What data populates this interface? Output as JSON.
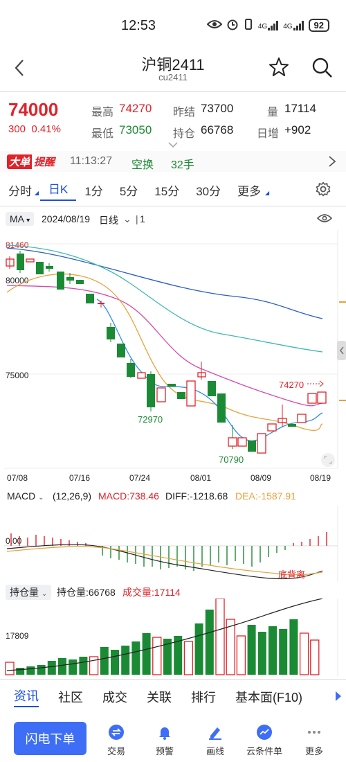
{
  "status": {
    "time": "12:53",
    "signal1": "4G",
    "signal2": "4G",
    "battery": "92"
  },
  "nav": {
    "title": "沪铜2411",
    "subtitle": "cu2411"
  },
  "quote": {
    "price": "74000",
    "change": "300",
    "change_pct": "0.41%",
    "stats": [
      {
        "label": "最高",
        "value": "74270",
        "color": "#e0222a"
      },
      {
        "label": "昨结",
        "value": "73700",
        "color": "#222222"
      },
      {
        "label": "量",
        "value": "17114",
        "color": "#222222"
      },
      {
        "label": "最低",
        "value": "73050",
        "color": "#1b8a34"
      },
      {
        "label": "持仓",
        "value": "66768",
        "color": "#222222"
      },
      {
        "label": "日增",
        "value": "+902",
        "color": "#222222"
      }
    ]
  },
  "alert": {
    "badge_left": "大单",
    "badge_right": "提醒",
    "time": "11:13:27",
    "type": "空换",
    "amount": "32手"
  },
  "tabs": [
    "分时",
    "日K",
    "1分",
    "5分",
    "15分",
    "30分",
    "更多"
  ],
  "active_tab": "日K",
  "ma_bar": {
    "indicator": "MA",
    "date": "2024/08/19",
    "period": "日线",
    "count": "1"
  },
  "kline": {
    "price_labels": [
      "81460",
      "80000",
      "75000"
    ],
    "annotations": {
      "low1": "72970",
      "low2": "70790",
      "high": "74270"
    },
    "dates": [
      "07/08",
      "07/16",
      "07/24",
      "08/01",
      "08/09",
      "08/19"
    ]
  },
  "macd": {
    "name": "MACD",
    "params": "(12,26,9)",
    "macd_label": "MACD:738.46",
    "diff_label": "DIFF:-1218.68",
    "dea_label": "DEA:-1587.91",
    "zero_label": "0.00",
    "note": "底背离"
  },
  "oi": {
    "name": "持仓量",
    "oi_label": "持仓量:66768",
    "vol_label": "成交量:17114",
    "level_label": "17809"
  },
  "bottom_tabs": [
    "资讯",
    "社区",
    "成交",
    "关联",
    "排行",
    "基本面(F10)"
  ],
  "actions": {
    "flash_label": "闪电下单",
    "items": [
      {
        "label": "交易",
        "icon": "trade-icon"
      },
      {
        "label": "预警",
        "icon": "bell-icon"
      },
      {
        "label": "画线",
        "icon": "draw-icon"
      },
      {
        "label": "云条件单",
        "icon": "cloud-order-icon"
      },
      {
        "label": "更多",
        "icon": "more-icon"
      }
    ]
  },
  "colors": {
    "up": "#e0222a",
    "down": "#1b8a34",
    "accent": "#3d6ef5",
    "ma_blue": "#2a5fc4",
    "ma_cyan": "#3fb9b0",
    "ma_magenta": "#d64aa8",
    "ma_orange": "#e8a23a"
  }
}
